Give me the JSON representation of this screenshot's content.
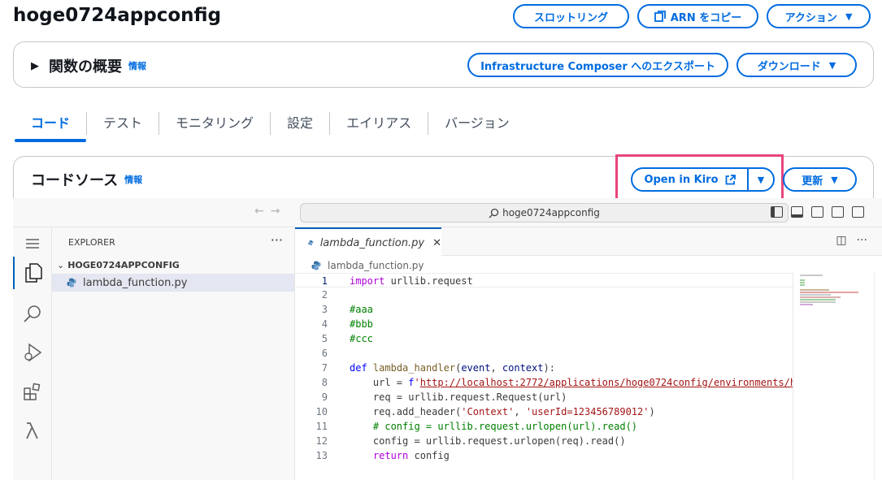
{
  "header": {
    "title": "hoge0724appconfig",
    "throttle_label": "スロットリング",
    "copy_arn_label": "ARN をコピー",
    "actions_label": "アクション"
  },
  "summary": {
    "title": "関数の概要",
    "info": "情報",
    "export_label": "Infrastructure Composer へのエクスポート",
    "download_label": "ダウンロード"
  },
  "tabs": [
    {
      "label": "コード",
      "active": true
    },
    {
      "label": "テスト",
      "active": false
    },
    {
      "label": "モニタリング",
      "active": false
    },
    {
      "label": "設定",
      "active": false
    },
    {
      "label": "エイリアス",
      "active": false
    },
    {
      "label": "バージョン",
      "active": false
    }
  ],
  "code_source": {
    "title": "コードソース",
    "info": "情報",
    "open_kiro_label": "Open in Kiro",
    "update_label": "更新"
  },
  "ide": {
    "search_text": "hoge0724appconfig",
    "explorer_header": "EXPLORER",
    "folder": "HOGE0724APPCONFIG",
    "file": "lambda_function.py",
    "editor_tab": "lambda_function.py",
    "breadcrumb": "lambda_function.py",
    "line_numbers": [
      "1",
      "2",
      "3",
      "4",
      "5",
      "6",
      "7",
      "8",
      "9",
      "10",
      "11",
      "12",
      "13"
    ]
  },
  "colors": {
    "accent": "#006ce0",
    "highlight": "#e8467c"
  },
  "icons": [
    "play-triangle-icon",
    "copy-icon",
    "external-link-icon",
    "search-icon",
    "files-icon",
    "run-debug-icon",
    "extensions-icon",
    "lambda-icon",
    "python-file-icon",
    "close-icon",
    "split-editor-icon"
  ]
}
